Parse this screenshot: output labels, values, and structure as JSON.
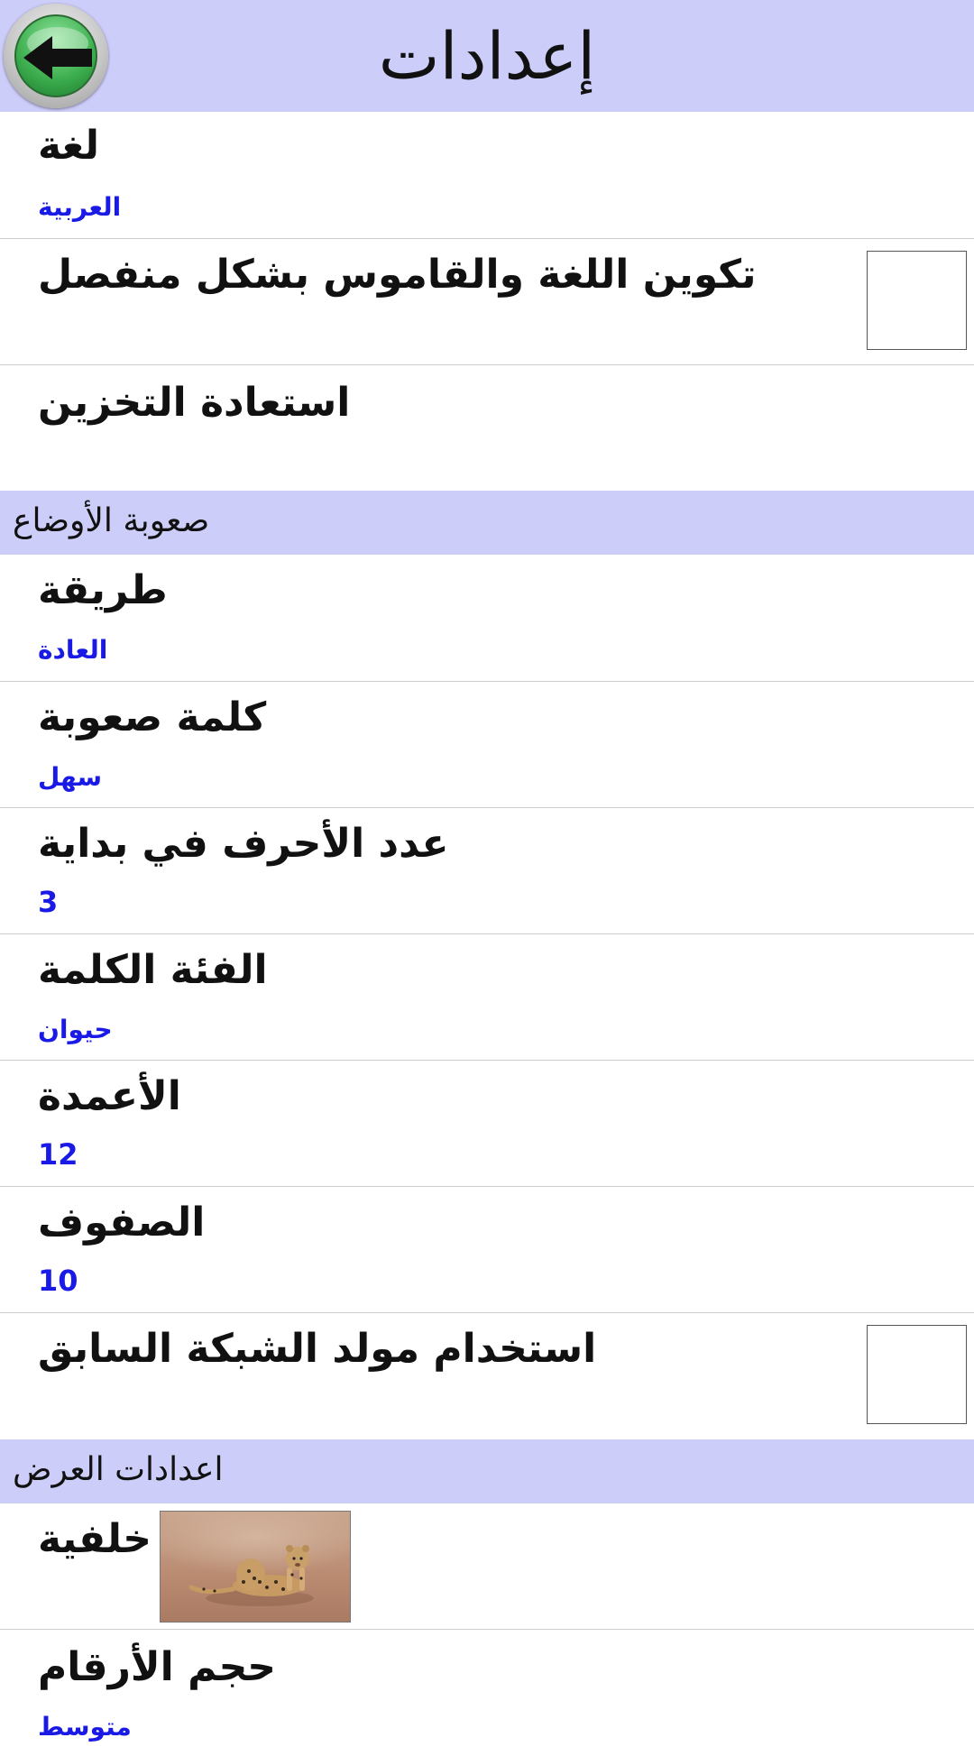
{
  "header": {
    "title": "إعدادات",
    "back_icon": "back-arrow-icon"
  },
  "rows": {
    "language": {
      "title": "لغة",
      "value": "العربية"
    },
    "separate_config": {
      "title": "تكوين اللغة والقاموس بشكل منفصل",
      "checked": false
    },
    "restore": {
      "title": "استعادة التخزين"
    },
    "method": {
      "title": "طريقة",
      "value": "العادة"
    },
    "word_difficulty": {
      "title": "كلمة صعوبة",
      "value": "سهل"
    },
    "start_letters": {
      "title": "عدد الأحرف في بداية",
      "value": "3"
    },
    "word_category": {
      "title": "الفئة الكلمة",
      "value": "حيوان"
    },
    "columns": {
      "title": "الأعمدة",
      "value": "12"
    },
    "rows_count": {
      "title": "الصفوف",
      "value": "10"
    },
    "prev_generator": {
      "title": "استخدام مولد الشبكة السابق",
      "checked": false
    },
    "background": {
      "title": "خلفية"
    },
    "number_size": {
      "title": "حجم الأرقام",
      "value": "متوسط"
    }
  },
  "sections": {
    "difficulty": "صعوبة الأوضاع",
    "display": "اعدادات العرض"
  },
  "colors": {
    "header_bg": "#cdcdf9",
    "value_text": "#1a1ae6",
    "divider": "#cccccc"
  }
}
